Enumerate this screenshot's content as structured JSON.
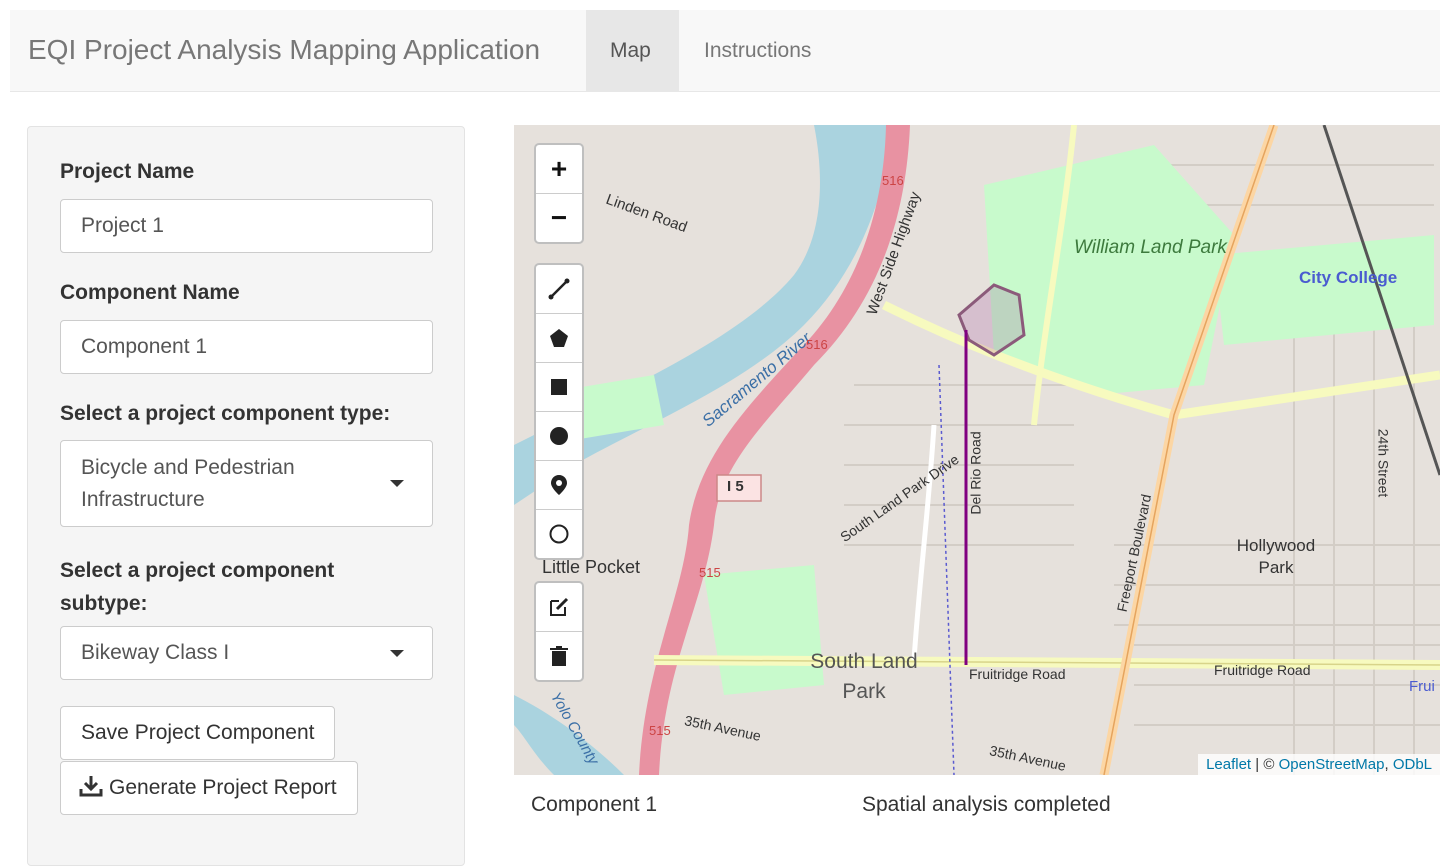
{
  "navbar": {
    "brand": "EQI Project Analysis Mapping Application",
    "tabs": [
      {
        "label": "Map",
        "active": true
      },
      {
        "label": "Instructions",
        "active": false
      }
    ]
  },
  "sidebar": {
    "project_name_label": "Project Name",
    "project_name_value": "Project 1",
    "component_name_label": "Component Name",
    "component_name_value": "Component 1",
    "component_type_label": "Select a project component type:",
    "component_type_value": "Bicycle and Pedestrian Infrastructure",
    "component_subtype_label": "Select a project component subtype:",
    "component_subtype_value": "Bikeway Class I",
    "save_button": "Save Project Component",
    "report_button": "Generate Project Report"
  },
  "map": {
    "zoom_in": "+",
    "zoom_out": "−",
    "draw_tools": [
      "draw-polyline-icon",
      "draw-polygon-icon",
      "draw-rectangle-icon",
      "draw-circle-icon",
      "draw-marker-icon",
      "draw-circlemarker-icon"
    ],
    "edit_tools": [
      "edit-layers-icon",
      "delete-layers-icon"
    ],
    "labels": {
      "william_land_park": "William Land Park",
      "city_college": "City College",
      "sacramento_river": "Sacramento River",
      "west_side_highway": "West Side Highway",
      "linden_road": "Linden Road",
      "little_pocket": "Little Pocket",
      "south_land_park": "South Land Park",
      "south_land_park_drive": "South Land Park Drive",
      "del_rio_road": "Del Rio Road",
      "freeport_boulevard": "Freeport Boulevard",
      "fruitridge_road": "Fruitridge Road",
      "hollywood_park": "Hollywood Park",
      "ave_35th": "35th Avenue",
      "street_24th": "24th Street",
      "yolo_county": "Yolo County",
      "i5": "I 5",
      "route_516": "516",
      "route_515": "515",
      "fruit_cut": "Frui"
    },
    "attribution": {
      "leaflet": "Leaflet",
      "sep": " | © ",
      "osm": "OpenStreetMap",
      "odbl": "ODbL"
    },
    "colors": {
      "water": "#aad3df",
      "park": "#c8facc",
      "highway": "#e892a2",
      "major_road": "#f7fabf",
      "drawn_line": "#800080"
    }
  },
  "status": {
    "component": "Component 1",
    "message": "Spatial analysis completed"
  }
}
